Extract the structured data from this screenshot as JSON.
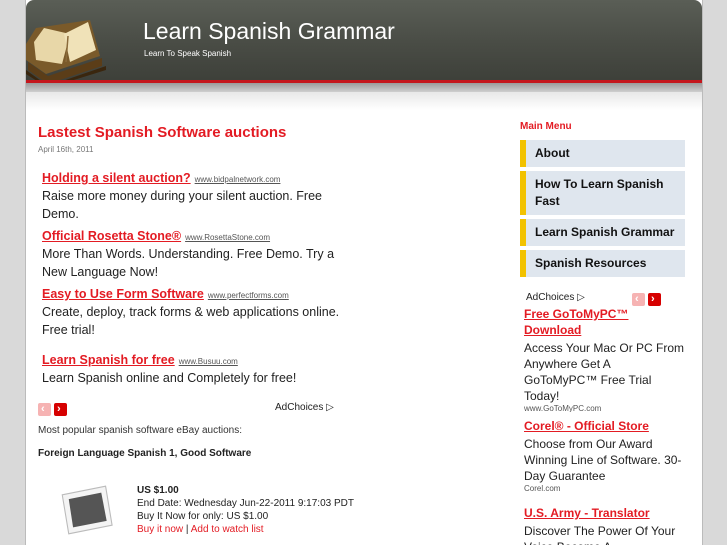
{
  "site": {
    "title": "Learn Spanish Grammar",
    "subtitle": "Learn To Speak Spanish"
  },
  "post": {
    "title": "Lastest Spanish Software auctions",
    "date": "April 16th, 2011"
  },
  "ads": [
    {
      "title": "Holding a silent auction?",
      "url": "www.bidpalnetwork.com",
      "text": "Raise more money during your silent auction. Free Demo."
    },
    {
      "title": "Official Rosetta Stone®",
      "url": "www.RosettaStone.com",
      "text": "More Than Words. Understanding. Free Demo. Try a New Language Now!"
    },
    {
      "title": "Easy to Use Form Software",
      "url": "www.perfectforms.com",
      "text": "Create, deploy, track forms & web applications online. Free trial!"
    },
    {
      "title": "Learn Spanish for free",
      "url": "www.Busuu.com",
      "text": "Learn Spanish online and Completely for free!"
    }
  ],
  "adchoices_label": "AdChoices",
  "ebay": {
    "intro": "Most popular spanish software eBay auctions:",
    "item_title": "Foreign Language Spanish 1, Good Software",
    "price": "US $1.00",
    "end_date": "End Date: Wednesday Jun-22-2011 9:17:03 PDT",
    "buy_now": "Buy It Now for only: US $1.00",
    "buy_link": "Buy it now",
    "separator": "|",
    "watch_link": "Add to watch list"
  },
  "sidebar": {
    "menu_heading": "Main Menu",
    "items": [
      {
        "label": "About"
      },
      {
        "label": "How To Learn Spanish Fast"
      },
      {
        "label": "Learn Spanish Grammar"
      },
      {
        "label": "Spanish Resources"
      }
    ],
    "ads": [
      {
        "title": "Free GoToMyPC™ Download",
        "text": "Access Your Mac Or PC From Anywhere Get A GoToMyPC™ Free Trial Today!",
        "url": "www.GoToMyPC.com"
      },
      {
        "title": "Corel® - Official Store",
        "text": "Choose from Our Award Winning Line of Software. 30-Day Guarantee",
        "url": "Corel.com"
      },
      {
        "title": "U.S. Army - Translator",
        "text": "Discover The Power Of Your Voice Become A"
      }
    ]
  },
  "nav_icons": {
    "prev": "chevron-left-icon",
    "next": "chevron-right-icon"
  },
  "colors": {
    "accent": "#e31b23",
    "menu_bg": "#dfe6ee",
    "menu_border": "#f2c200",
    "header_bg": "#4a4d46"
  }
}
